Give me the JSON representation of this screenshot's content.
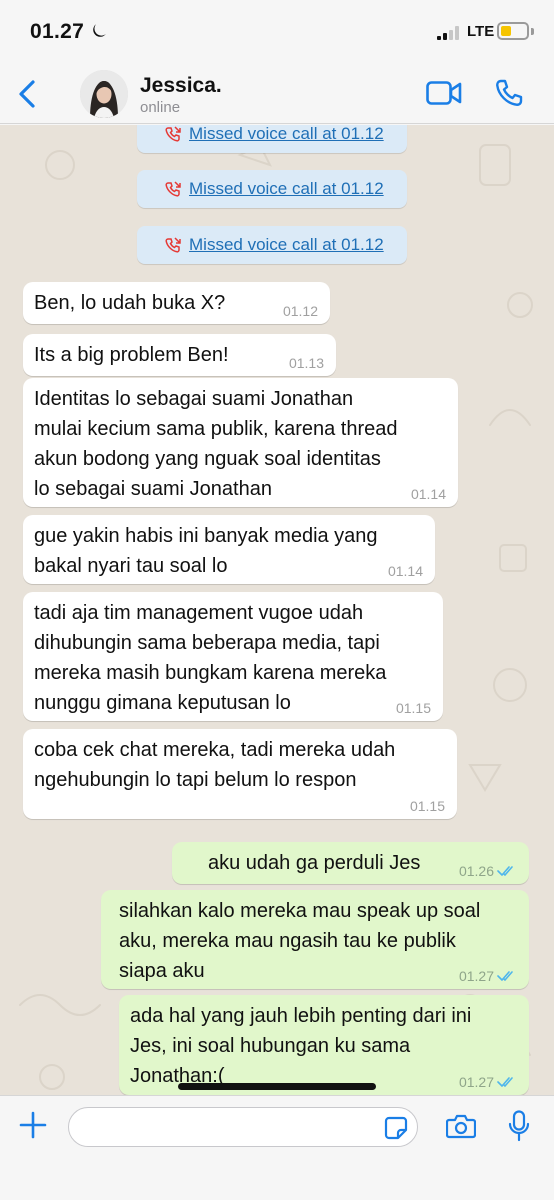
{
  "status_bar": {
    "time": "01.27",
    "network": "LTE",
    "battery_level": 0.35
  },
  "header": {
    "name": "Jessica.",
    "status": "online"
  },
  "system_messages": [
    {
      "text": "Missed voice call at 01.12"
    },
    {
      "text": "Missed voice call at 01.12"
    },
    {
      "text": "Missed voice call at 01.12"
    }
  ],
  "messages": [
    {
      "direction": "in",
      "text": "Ben, lo udah buka X?",
      "time": "01.12"
    },
    {
      "direction": "in",
      "text": "Its a big problem Ben!",
      "time": "01.13"
    },
    {
      "direction": "in",
      "text": "Identitas lo sebagai suami Jonathan\nmulai kecium sama publik, karena thread\nakun bodong yang nguak soal identitas\nlo sebagai suami Jonathan",
      "time": "01.14"
    },
    {
      "direction": "in",
      "text": "gue yakin habis ini banyak media yang\nbakal nyari tau soal lo",
      "time": "01.14"
    },
    {
      "direction": "in",
      "text": "tadi aja tim management vugoe udah\ndihubungin sama beberapa media, tapi\nmereka masih bungkam karena mereka\nnunggu gimana keputusan lo",
      "time": "01.15"
    },
    {
      "direction": "in",
      "text": "coba cek chat mereka, tadi mereka udah\nngehubungin lo tapi belum lo respon",
      "time": "01.15"
    },
    {
      "direction": "out",
      "text": "aku udah ga perduli Jes",
      "time": "01.26"
    },
    {
      "direction": "out",
      "text": "silahkan kalo mereka mau speak up soal\naku, mereka mau ngasih tau ke publik\nsiapa aku",
      "time": "01.27"
    },
    {
      "direction": "out",
      "text": "ada hal yang jauh lebih penting dari ini\nJes, ini soal hubungan ku sama\nJonathan:(",
      "time": "01.27"
    }
  ],
  "composer": {
    "placeholder": ""
  },
  "colors": {
    "accent": "#1a7ee6",
    "incoming_bubble": "#ffffff",
    "outgoing_bubble": "#e1f7cb",
    "system_bubble": "#dbeaf7",
    "missed_call": "#e53935",
    "read_ticks": "#4fb6ec",
    "wallpaper": "#e8e2d9"
  },
  "icons": {
    "back": "chevron-left-icon",
    "video": "video-camera-icon",
    "call": "phone-icon",
    "missed_call": "missed-call-icon",
    "read_receipt": "double-check-icon",
    "attach": "plus-icon",
    "sticker": "sticker-icon",
    "camera": "camera-icon",
    "mic": "microphone-icon"
  }
}
